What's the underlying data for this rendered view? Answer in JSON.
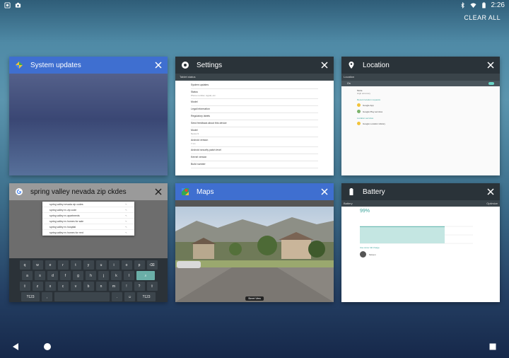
{
  "status_bar": {
    "time": "2:26"
  },
  "recents": {
    "clear_all_label": "CLEAR ALL"
  },
  "cards": [
    {
      "title": "System updates",
      "header_color": "#3f6fd0"
    },
    {
      "title": "Settings",
      "header_color": "#2a3339",
      "content": {
        "toolbar": "Tablet status",
        "items": [
          {
            "label": "System updates",
            "sub": ""
          },
          {
            "label": "Status",
            "sub": "Phone number, signal, etc."
          },
          {
            "label": "Model",
            "sub": ""
          },
          {
            "label": "Legal information",
            "sub": ""
          },
          {
            "label": "Regulatory labels",
            "sub": ""
          },
          {
            "label": "Send feedback about this device",
            "sub": ""
          },
          {
            "label": "Model",
            "sub": "Nexus 9"
          },
          {
            "label": "Android version",
            "sub": "7.1.1"
          },
          {
            "label": "Android security patch level",
            "sub": ""
          },
          {
            "label": "Kernel version",
            "sub": ""
          },
          {
            "label": "Build number",
            "sub": ""
          }
        ]
      }
    },
    {
      "title": "Location",
      "header_color": "#2a3339",
      "content": {
        "toolbar": "Location",
        "switch_label": "On",
        "mode_label": "Mode",
        "mode_value": "High accuracy",
        "section_recent": "Recent location requests",
        "recent": [
          "Google App",
          "Google Play services"
        ],
        "section_services": "Location services",
        "services": [
          "Google Location History"
        ]
      }
    },
    {
      "title": "spring valley nevada zip ckdes",
      "header_color": "#9a9a9a",
      "content": {
        "suggestions": [
          "spring valley nevada zip codes",
          "spring valley nv zip code",
          "spring valley nv apartments",
          "spring valley nv homes for sale",
          "spring valley nv hospital",
          "spring valley nv homes for rent"
        ],
        "keyboard": [
          [
            "q",
            "w",
            "e",
            "r",
            "t",
            "y",
            "u",
            "i",
            "o",
            "p"
          ],
          [
            "a",
            "s",
            "d",
            "f",
            "g",
            "h",
            "j",
            "k",
            "l"
          ],
          [
            "z",
            "x",
            "c",
            "v",
            "b",
            "n",
            "m",
            "!",
            "?"
          ],
          [
            "?123",
            ",",
            "",
            "",
            "."
          ]
        ]
      }
    },
    {
      "title": "Maps",
      "header_color": "#3f6fd0",
      "content": {
        "caption": "Street View"
      }
    },
    {
      "title": "Battery",
      "header_color": "#2a3339",
      "content": {
        "toolbar": "Battery",
        "toolbar_right": "Optimize",
        "level_text": "99%",
        "level_percent": 99,
        "section_usage": "Use since full charge",
        "usage_item": "Screen"
      }
    }
  ]
}
